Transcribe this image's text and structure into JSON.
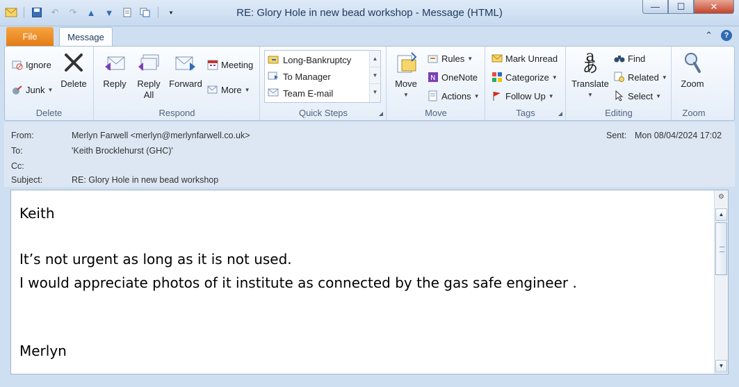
{
  "window": {
    "title": "RE: Glory Hole in new bead workshop  -  Message (HTML)",
    "minimize": "—",
    "maximize": "☐",
    "close": "✕"
  },
  "qat": {
    "icons": [
      "mail-icon",
      "save-icon",
      "undo-icon",
      "redo-icon",
      "previous-icon",
      "next-icon",
      "print-icon",
      "copy-icon",
      "customize-icon"
    ]
  },
  "tabs": {
    "file": "File",
    "message": "Message"
  },
  "ribbon": {
    "delete_group": {
      "label": "Delete",
      "ignore": "Ignore",
      "junk": "Junk",
      "delete": "Delete"
    },
    "respond_group": {
      "label": "Respond",
      "reply": "Reply",
      "reply_all_1": "Reply",
      "reply_all_2": "All",
      "forward": "Forward",
      "meeting": "Meeting",
      "more": "More"
    },
    "quick_steps_group": {
      "label": "Quick Steps",
      "items": [
        "Long-Bankruptcy",
        "To Manager",
        "Team E-mail"
      ]
    },
    "move_group": {
      "label": "Move",
      "move": "Move",
      "rules": "Rules",
      "onenote": "OneNote",
      "actions": "Actions"
    },
    "tags_group": {
      "label": "Tags",
      "mark_unread": "Mark Unread",
      "categorize": "Categorize",
      "follow_up": "Follow Up"
    },
    "editing_group": {
      "label": "Editing",
      "translate": "Translate",
      "find": "Find",
      "related": "Related",
      "select": "Select"
    },
    "zoom_group": {
      "label": "Zoom",
      "zoom": "Zoom"
    }
  },
  "header": {
    "from_label": "From:",
    "from_value": "Merlyn Farwell <merlyn@merlynfarwell.co.uk>",
    "to_label": "To:",
    "to_value": "'Keith Brocklehurst (GHC)'",
    "cc_label": "Cc:",
    "cc_value": "",
    "subject_label": "Subject:",
    "subject_value": "RE: Glory Hole in new bead workshop",
    "sent_label": "Sent:",
    "sent_value": "Mon 08/04/2024 17:02"
  },
  "body": {
    "greeting": "Keith",
    "line1": "It’s not urgent as long as it is not used.",
    "line2": "I would appreciate photos of it institute as connected by the gas safe engineer .",
    "signature": "Merlyn"
  },
  "colors": {
    "file_tab": "#e37c15",
    "title_text": "#1e395b",
    "close_button": "#c4432c"
  }
}
